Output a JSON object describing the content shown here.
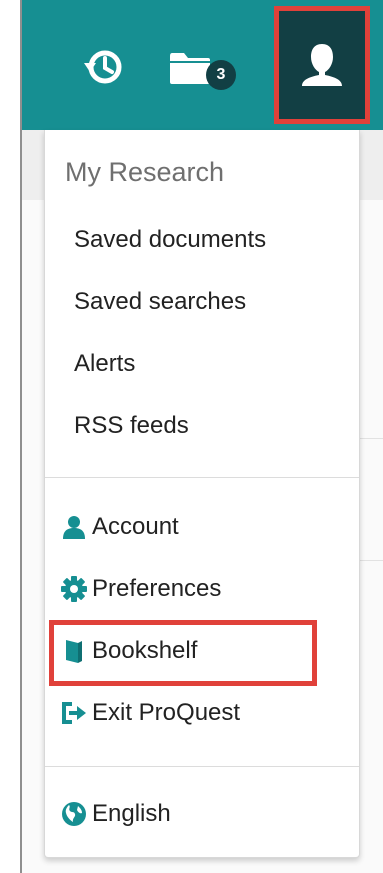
{
  "header": {
    "background_color": "#168f92",
    "icons": {
      "history": "history-icon",
      "folder": "folder-icon",
      "user": "user-icon"
    },
    "folder_count": "3",
    "active_color": "#123f44",
    "highlight_color": "#e0413a"
  },
  "dropdown": {
    "section_title": "My Research",
    "research_items": [
      {
        "label": "Saved documents"
      },
      {
        "label": "Saved searches"
      },
      {
        "label": "Alerts"
      },
      {
        "label": "RSS feeds"
      }
    ],
    "account_items": [
      {
        "label": "Account",
        "icon": "user-icon"
      },
      {
        "label": "Preferences",
        "icon": "gear-icon"
      },
      {
        "label": "Bookshelf",
        "icon": "book-icon"
      },
      {
        "label": "Exit ProQuest",
        "icon": "sign-out-icon"
      }
    ],
    "language": {
      "label": "English",
      "icon": "globe-icon"
    },
    "icon_color": "#168f92"
  }
}
